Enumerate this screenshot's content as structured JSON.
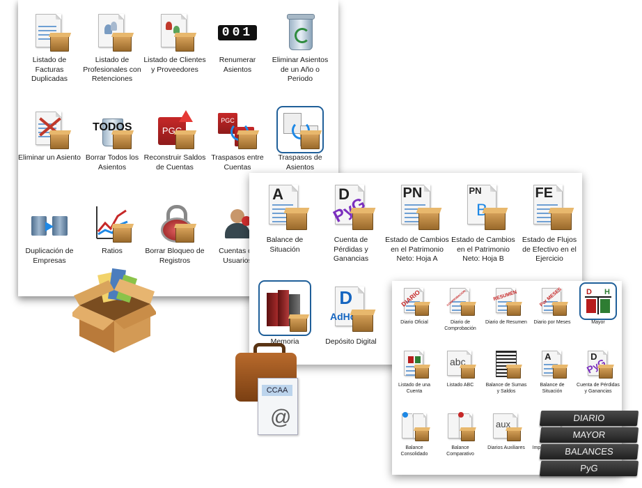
{
  "panel_main": {
    "tiles": [
      {
        "label": "Listado de Facturas Duplicadas",
        "icon": "duplicate-invoices-list-icon"
      },
      {
        "label": "Listado de Profesionales con Retenciones",
        "icon": "professionals-withholdings-list-icon"
      },
      {
        "label": "Listado de Clientes y Proveedores",
        "icon": "clients-suppliers-list-icon"
      },
      {
        "label": "Renumerar Asientos",
        "icon": "renumber-entries-icon",
        "counter": "001"
      },
      {
        "label": "Eliminar Asientos de un Año o Periodo",
        "icon": "recycle-bin-icon"
      },
      {
        "label": "Eliminar un Asiento",
        "icon": "delete-entry-icon"
      },
      {
        "label": "Borrar Todos los Asientos",
        "icon": "delete-all-entries-icon",
        "badge": "TODOS"
      },
      {
        "label": "Reconstruir Saldos de Cuentas",
        "icon": "rebuild-balances-icon",
        "badge": "PGC"
      },
      {
        "label": "Traspasos entre Cuentas",
        "icon": "transfers-between-accounts-icon",
        "badge": "PGC"
      },
      {
        "label": "Traspasos de Asientos",
        "icon": "transfer-entries-icon"
      },
      {
        "label": "Duplicación de Empresas",
        "icon": "duplicate-companies-icon"
      },
      {
        "label": "Ratios",
        "icon": "ratios-chart-icon"
      },
      {
        "label": "Borrar Bloqueo de Registros",
        "icon": "unlock-records-icon"
      },
      {
        "label": "Cuentas de Usuarios",
        "icon": "user-accounts-icon"
      }
    ]
  },
  "panel_reports": {
    "tiles": [
      {
        "label": "Balance de Situación",
        "icon": "balance-sheet-icon",
        "letter": "A"
      },
      {
        "label": "Cuenta de Pérdidas y Ganancias",
        "icon": "profit-loss-icon",
        "letter": "D",
        "overlay": "PyG"
      },
      {
        "label": "Estado de Cambios en el Patrimonio Neto: Hoja A",
        "icon": "equity-changes-a-icon",
        "letter": "PN"
      },
      {
        "label": "Estado de Cambios en el Patrimonio Neto: Hoja B",
        "icon": "equity-changes-b-icon",
        "letter": "PN",
        "sub": "B"
      },
      {
        "label": "Estado de Flujos de Efectivo en el Ejercicio",
        "icon": "cash-flow-icon",
        "letter": "FE"
      },
      {
        "label": "Memoria",
        "icon": "memoria-books-icon"
      },
      {
        "label": "Depósito Digital",
        "icon": "digital-deposit-icon",
        "letter": "D",
        "sub": "AdHoc"
      }
    ]
  },
  "panel_books": {
    "tiles": [
      {
        "label": "Diario Oficial",
        "icon": "diario-oficial-icon",
        "stamp": "DIARIO"
      },
      {
        "label": "Diario de Comprobación",
        "icon": "diario-comprobacion-icon",
        "stamp": "COMPROBACION"
      },
      {
        "label": "Diario de Resumen",
        "icon": "diario-resumen-icon",
        "stamp": "RESUMEN"
      },
      {
        "label": "Diario por Meses",
        "icon": "diario-meses-icon",
        "stamp": "Por MESES"
      },
      {
        "label": "Mayor",
        "icon": "mayor-ledger-icon",
        "letter": "D",
        "sub": "H"
      },
      {
        "label": "Listado de una Cuenta",
        "icon": "account-listing-icon"
      },
      {
        "label": "Listado ABC",
        "icon": "abc-listing-icon",
        "badge": "abc"
      },
      {
        "label": "Balance de Sumas y Saldos",
        "icon": "trial-balance-icon"
      },
      {
        "label": "Balance de Situación",
        "icon": "balance-situacion-small-icon",
        "letter": "A"
      },
      {
        "label": "Cuenta de Pérdidas y Ganancias",
        "icon": "pyg-small-icon",
        "letter": "D",
        "overlay": "PyG"
      },
      {
        "label": "Balance Consolidado",
        "icon": "consolidated-balance-icon"
      },
      {
        "label": "Balance Comparativo",
        "icon": "comparative-balance-icon"
      },
      {
        "label": "Diarios Auxiliares",
        "icon": "auxiliary-journals-icon",
        "badge": "aux"
      },
      {
        "label": "Imprimir Todos los Libros",
        "icon": "print-all-books-icon"
      }
    ]
  },
  "briefcase": {
    "card": "CCAA",
    "glyph": "@"
  },
  "books_stack": [
    "DIARIO",
    "MAYOR",
    "BALANCES",
    "PyG"
  ],
  "colors": {
    "selection": "#1f5f99",
    "box_tan": "#d9a45c",
    "doc_blue": "#6e9fd3",
    "pdf_red": "#b71c1c",
    "dark_green": "#2e7d32"
  }
}
